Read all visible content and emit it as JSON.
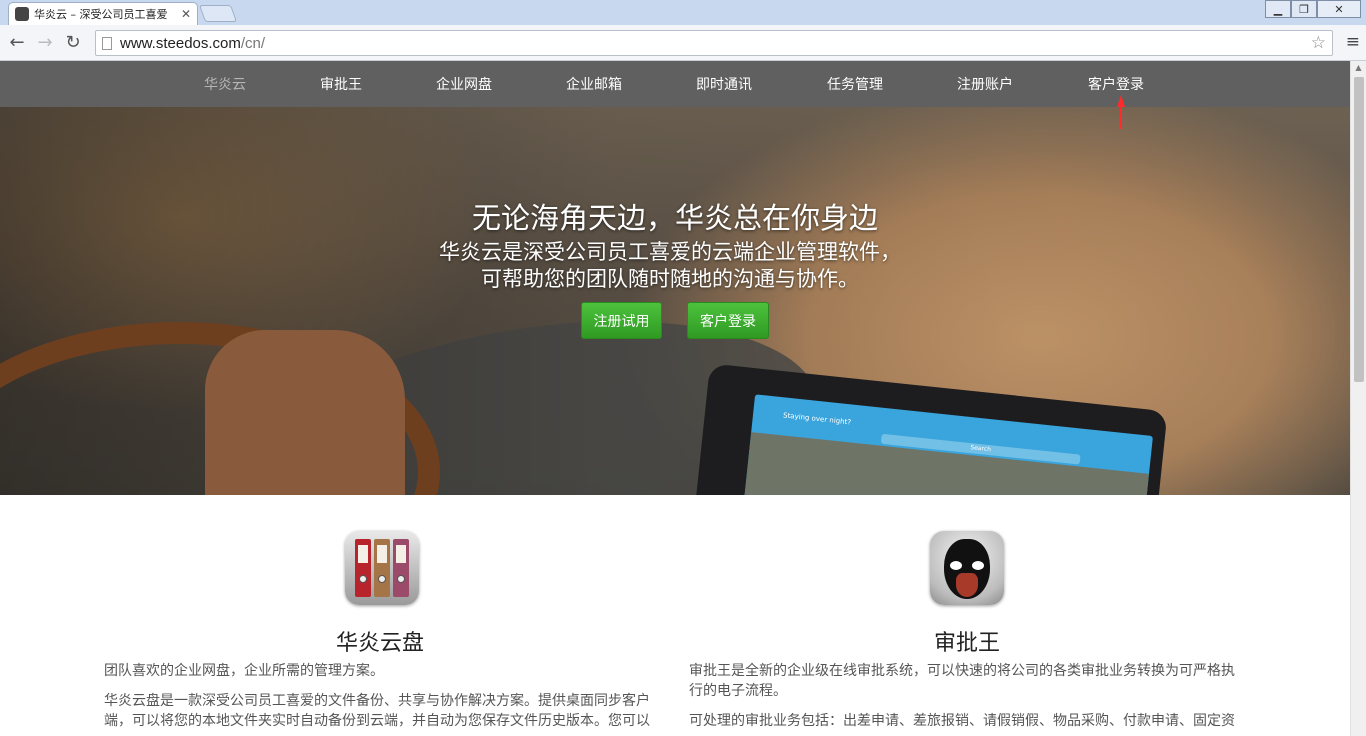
{
  "browser": {
    "tab_title": "华炎云 – 深受公司员工喜爱",
    "tab_close": "✕",
    "url_host": "www.steedos.com",
    "url_path": "/cn/",
    "back_glyph": "←",
    "forward_glyph": "→",
    "reload_glyph": "↻",
    "star_glyph": "☆",
    "menu_glyph": "≡",
    "min_glyph": "▁",
    "restore_glyph": "❐",
    "close_glyph": "✕"
  },
  "nav": {
    "items": [
      "华炎云",
      "审批王",
      "企业网盘",
      "企业邮箱",
      "即时通讯",
      "任务管理",
      "注册账户",
      "客户登录"
    ]
  },
  "hero": {
    "title": "无论海角天边，华炎总在你身边",
    "subtitle_line1": "华炎云是深受公司员工喜爱的云端企业管理软件，",
    "subtitle_line2": "可帮助您的团队随时随地的沟通与协作。",
    "btn_register": "注册试用",
    "btn_login": "客户登录",
    "tablet_label": "Staying over night?",
    "tablet_search": "Search"
  },
  "products": [
    {
      "title": "华炎云盘",
      "lead": "团队喜欢的企业网盘，企业所需的管理方案。",
      "body": "华炎云盘是一款深受公司员工喜爱的文件备份、共享与协作解决方案。提供桌面同步客户端，可以将您的本地文件夹实时自动备份到云端，并自动为您保存文件历史版本。您可以"
    },
    {
      "title": "审批王",
      "lead": "审批王是全新的企业级在线审批系统，可以快速的将公司的各类审批业务转换为可严格执行的电子流程。",
      "body": "可处理的审批业务包括：出差申请、差旅报销、请假销假、物品采购、付款申请、固定资"
    }
  ],
  "colors": {
    "nav_bg": "#606060",
    "nav_active": "#b5b5b5",
    "button_green": "#3aae2c",
    "annotation_arrow": "#ff2b2b"
  },
  "icons": [
    "binders-app-icon",
    "opera-mask-app-icon"
  ]
}
